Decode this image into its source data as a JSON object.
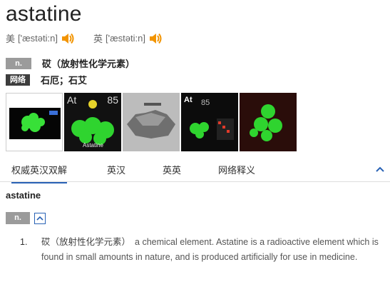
{
  "entry": {
    "word": "astatine",
    "phonetics": [
      {
        "region": "美",
        "ipa": "['æstəti:n]"
      },
      {
        "region": "英",
        "ipa": "['æstəti:n]"
      }
    ]
  },
  "basic": {
    "pos": "n.",
    "pos_meaning": "砹（放射性化学元素）",
    "web_tag": "网络",
    "web_meaning": "石厄；石艾"
  },
  "images": {
    "im2_label": "At",
    "im2_number": "85",
    "im2_caption": "Astatine",
    "im4_label": "At",
    "im4_number": "85"
  },
  "tabs": [
    {
      "label": "权威英汉双解",
      "active": true
    },
    {
      "label": "英汉",
      "active": false
    },
    {
      "label": "英英",
      "active": false
    },
    {
      "label": "网络释义",
      "active": false
    }
  ],
  "detail": {
    "headword": "astatine",
    "pos": "n.",
    "senses": [
      {
        "num": "1.",
        "cn": "砹（放射性化学元素）",
        "en": "a chemical element. Astatine is a radioactive element which is found in small amounts in nature, and is produced artificially for use in medicine."
      }
    ]
  },
  "colors": {
    "accent": "#2962b5",
    "speaker": "#f29400",
    "tag_gray": "#9b9b9b",
    "tag_dark": "#3d3d3d"
  }
}
